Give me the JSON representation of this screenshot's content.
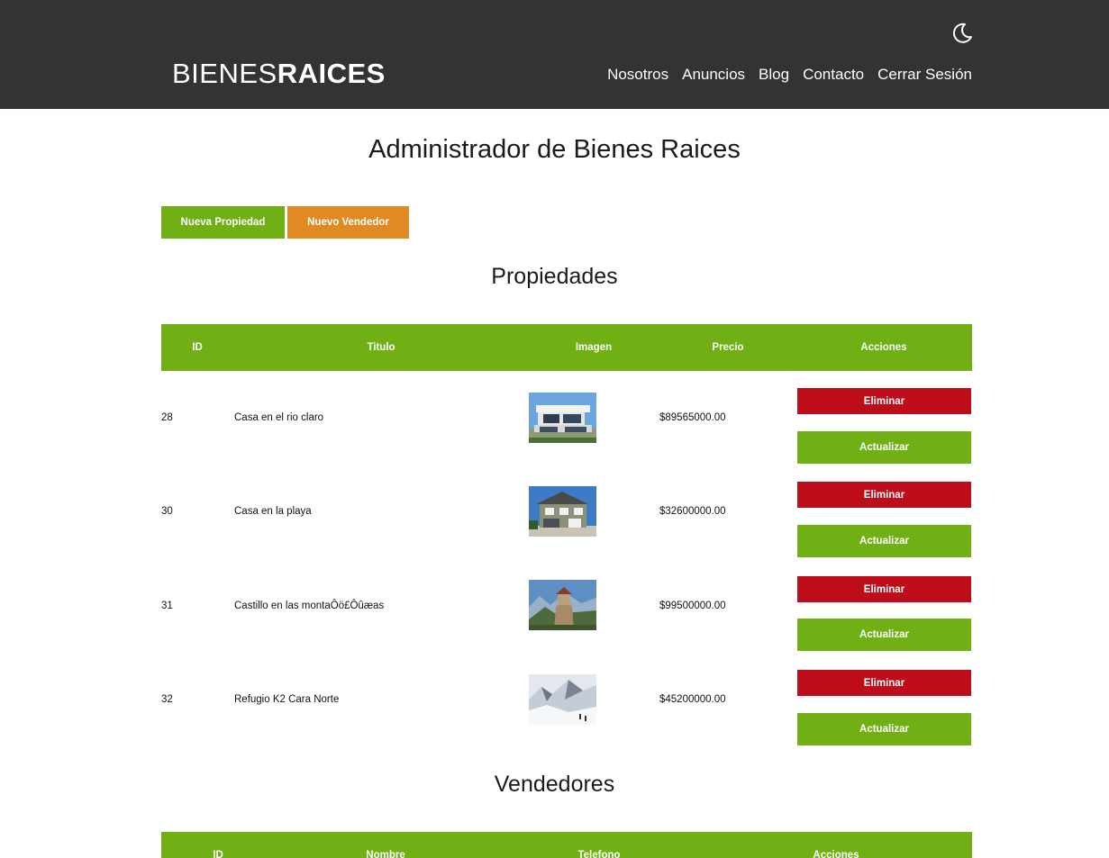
{
  "header": {
    "logo_light": "BIENES",
    "logo_bold": "RAICES",
    "nav": [
      "Nosotros",
      "Anuncios",
      "Blog",
      "Contacto",
      "Cerrar Sesión"
    ],
    "theme_toggle_icon": "moon-icon"
  },
  "main": {
    "title": "Administrador de Bienes Raices",
    "actions": {
      "new_property": "Nueva Propiedad",
      "new_seller": "Nuevo Vendedor"
    }
  },
  "properties": {
    "title": "Propiedades",
    "columns": [
      "ID",
      "Titulo",
      "Imagen",
      "Precio",
      "Acciones"
    ],
    "rows": [
      {
        "id": "28",
        "title": "Casa en el rio claro",
        "image": "modern-house-photo",
        "price": "$89565000.00",
        "delete_label": "Eliminar",
        "update_label": "Actualizar"
      },
      {
        "id": "30",
        "title": "Casa en la playa",
        "image": "two-story-house-photo",
        "price": "$32600000.00",
        "delete_label": "Eliminar",
        "update_label": "Actualizar"
      },
      {
        "id": "31",
        "title": "Castillo en las montaÔö£Ôûæas",
        "image": "castle-on-cliff-photo",
        "price": "$99500000.00",
        "delete_label": "Eliminar",
        "update_label": "Actualizar"
      },
      {
        "id": "32",
        "title": "Refugio K2 Cara Norte",
        "image": "snowy-mountain-photo",
        "price": "$45200000.00",
        "delete_label": "Eliminar",
        "update_label": "Actualizar"
      }
    ]
  },
  "sellers": {
    "title": "Vendedores",
    "columns": [
      "ID",
      "Nombre",
      "Telefono",
      "Acciones"
    ]
  },
  "colors": {
    "header_bg": "#333333",
    "primary_green": "#71b015",
    "orange": "#e08a24",
    "danger_red": "#bd0d1a"
  }
}
